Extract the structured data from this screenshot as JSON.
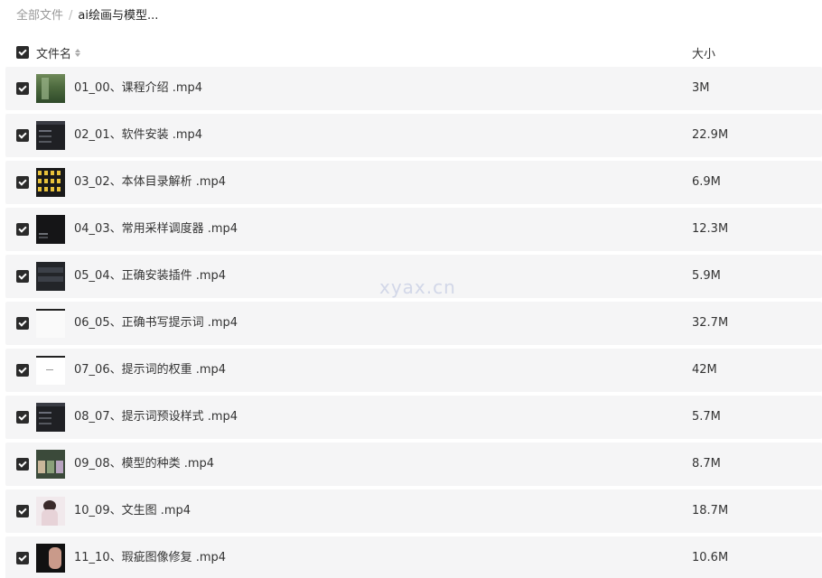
{
  "breadcrumb": {
    "root": "全部文件",
    "separator": "/",
    "current": "ai绘画与模型..."
  },
  "header": {
    "name_label": "文件名",
    "size_label": "大小"
  },
  "files": [
    {
      "name": "01_00、课程介绍 .mp4",
      "size": "3M",
      "thumb": "green"
    },
    {
      "name": "02_01、软件安装 .mp4",
      "size": "22.9M",
      "thumb": "dark"
    },
    {
      "name": "03_02、本体目录解析 .mp4",
      "size": "6.9M",
      "thumb": "yellow"
    },
    {
      "name": "04_03、常用采样调度器 .mp4",
      "size": "12.3M",
      "thumb": "black"
    },
    {
      "name": "05_04、正确安装插件 .mp4",
      "size": "5.9M",
      "thumb": "panel"
    },
    {
      "name": "06_05、正确书写提示词 .mp4",
      "size": "32.7M",
      "thumb": "white"
    },
    {
      "name": "07_06、提示词的权重 .mp4",
      "size": "42M",
      "thumb": "white2"
    },
    {
      "name": "08_07、提示词预设样式 .mp4",
      "size": "5.7M",
      "thumb": "dark"
    },
    {
      "name": "09_08、模型的种类 .mp4",
      "size": "8.7M",
      "thumb": "models"
    },
    {
      "name": "10_09、文生图 .mp4",
      "size": "18.7M",
      "thumb": "person"
    },
    {
      "name": "11_10、瑕疵图像修复 .mp4",
      "size": "10.6M",
      "thumb": "face"
    }
  ],
  "watermark": "xyax.cn"
}
